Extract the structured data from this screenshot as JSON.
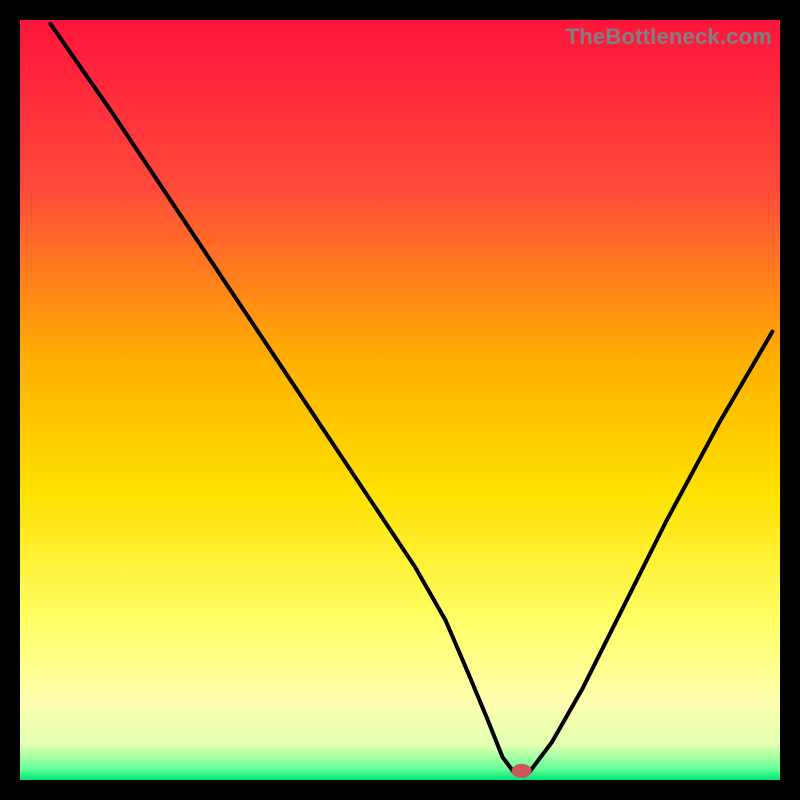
{
  "watermark": "TheBottleneck.com",
  "chart_data": {
    "type": "line",
    "title": "",
    "xlabel": "",
    "ylabel": "",
    "xlim": [
      0,
      100
    ],
    "ylim": [
      0,
      100
    ],
    "grid": false,
    "legend": false,
    "background_gradient_stops": [
      {
        "offset": 0.0,
        "color": "#ff143c"
      },
      {
        "offset": 0.22,
        "color": "#ff4a3a"
      },
      {
        "offset": 0.45,
        "color": "#ffb000"
      },
      {
        "offset": 0.62,
        "color": "#ffe100"
      },
      {
        "offset": 0.79,
        "color": "#ffff66"
      },
      {
        "offset": 0.9,
        "color": "#ffffb0"
      },
      {
        "offset": 0.955,
        "color": "#e0ffb0"
      },
      {
        "offset": 0.985,
        "color": "#66ff99"
      },
      {
        "offset": 1.0,
        "color": "#00e676"
      }
    ],
    "series": [
      {
        "name": "bottleneck-curve",
        "color": "#000000",
        "x": [
          4.0,
          12.0,
          20.0,
          28.0,
          34.0,
          40.0,
          46.0,
          52.0,
          56.0,
          59.0,
          61.5,
          63.5,
          65.0,
          67.0,
          70.0,
          74.0,
          79.0,
          85.0,
          92.0,
          99.0
        ],
        "y": [
          99.5,
          88.0,
          76.0,
          64.0,
          55.0,
          46.0,
          37.0,
          28.0,
          21.0,
          14.0,
          8.0,
          3.0,
          1.0,
          1.0,
          5.0,
          12.0,
          22.0,
          34.0,
          47.0,
          59.0
        ]
      }
    ],
    "marker": {
      "name": "optimal-point",
      "x": 66.0,
      "y": 1.2,
      "color": "#d0555a"
    }
  }
}
